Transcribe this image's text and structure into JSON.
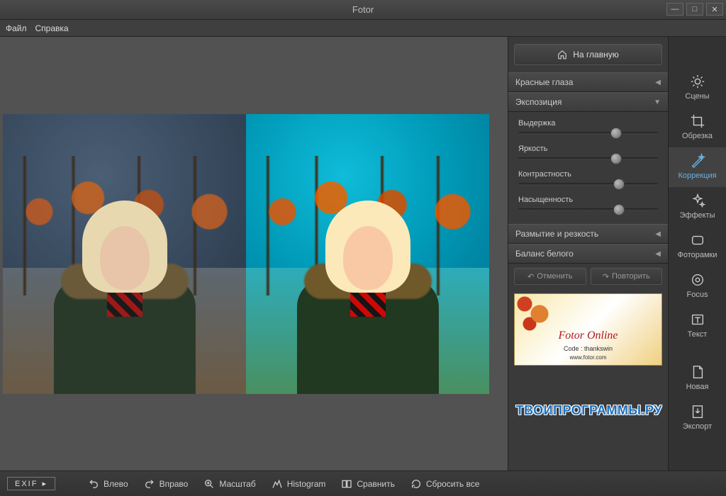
{
  "window": {
    "title": "Fotor"
  },
  "menu": {
    "file": "Файл",
    "help": "Справка"
  },
  "home_button": "На главную",
  "panels": {
    "red_eye": "Красные глаза",
    "exposure": "Экспозиция",
    "blur_sharp": "Размытие и резкость",
    "white_balance": "Баланс белого"
  },
  "sliders": {
    "exposure": {
      "label": "Выдержка",
      "value": 70
    },
    "brightness": {
      "label": "Яркость",
      "value": 70
    },
    "contrast": {
      "label": "Контрастность",
      "value": 72
    },
    "saturation": {
      "label": "Насыщенность",
      "value": 72
    }
  },
  "undo": "Отменить",
  "redo": "Повторить",
  "promo": {
    "headline": "Fotor Online",
    "code": "Code : thankswin",
    "url": "www.fotor.com"
  },
  "watermark": "ТВОИПРОГРАММЫ.РУ",
  "tools": {
    "scenes": "Сцены",
    "crop": "Обрезка",
    "correction": "Коррекция",
    "effects": "Эффекты",
    "frames": "Фоторамки",
    "focus": "Focus",
    "text": "Текст",
    "new": "Новая",
    "export": "Экспорт"
  },
  "bottom": {
    "exif": "EXIF",
    "left": "Влево",
    "right": "Вправо",
    "scale": "Масштаб",
    "histogram": "Histogram",
    "compare": "Сравнить",
    "reset": "Сбросить все"
  }
}
